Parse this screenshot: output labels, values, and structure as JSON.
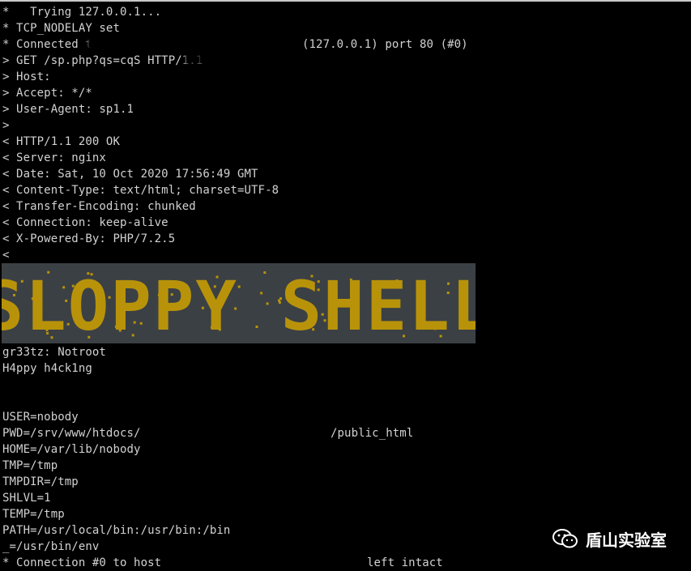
{
  "terminal": {
    "lines_top": [
      "*   Trying 127.0.0.1...",
      "* TCP_NODELAY set",
      "* Connected to",
      "> GET /sp.php?qs=cqS HTTP/1.1",
      "> Host:",
      "> Accept: */*",
      "> User-Agent: sp1.1",
      ">",
      "< HTTP/1.1 200 OK",
      "< Server: nginx",
      "< Date: Sat, 10 Oct 2020 17:56:49 GMT",
      "< Content-Type: text/html; charset=UTF-8",
      "< Transfer-Encoding: chunked",
      "< Connection: keep-alive",
      "< X-Powered-By: PHP/7.2.5",
      "<"
    ],
    "connected_suffix": "(127.0.0.1) port 80 (#0)",
    "banner_text": "SLOPPY SHELL",
    "lines_bottom": [
      "gr33tz: Notroot",
      "H4ppy h4ck1ng",
      "",
      "",
      "USER=nobody",
      "PWD=/srv/www/htdocs/",
      "HOME=/var/lib/nobody",
      "TMP=/tmp",
      "TMPDIR=/tmp",
      "SHLVL=1",
      "TEMP=/tmp",
      "PATH=/usr/local/bin:/usr/bin:/bin",
      "_=/usr/bin/env",
      "* Connection #0 to host"
    ],
    "pwd_suffix": "/public_html",
    "closing_suffix": "left intact"
  },
  "watermark": {
    "label": "盾山实验室",
    "icon": "wechat-icon"
  },
  "colors": {
    "background": "#000000",
    "text": "#d2d2d2",
    "banner_bg": "#3b4044",
    "banner_fg": "#b8930a"
  }
}
